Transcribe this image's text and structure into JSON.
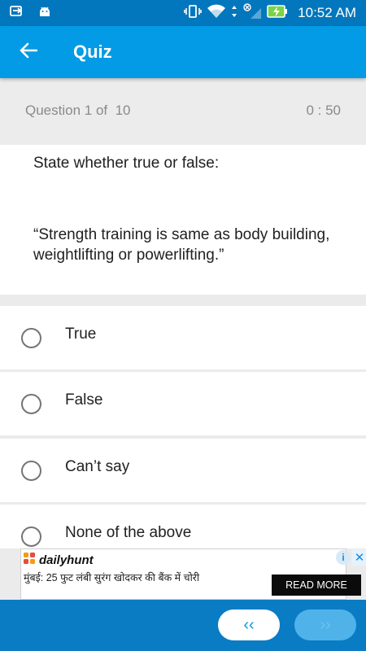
{
  "status_bar": {
    "time": "10:52 AM",
    "icons": [
      "usb-icon",
      "android-icon",
      "vibrate-icon",
      "wifi-icon",
      "data-arrows-icon",
      "no-sim-icon",
      "signal-icon",
      "battery-charging-icon"
    ]
  },
  "app_bar": {
    "title": "Quiz",
    "back_icon": "arrow-back-icon"
  },
  "question_header": {
    "counter": "Question 1 of  10",
    "timer": "0 : 50"
  },
  "question": {
    "instruction": "State whether true or false:",
    "statement": "“Strength training is same as body building, weightlifting or powerlifting.”"
  },
  "options": [
    {
      "label": "True",
      "selected": false
    },
    {
      "label": "False",
      "selected": false
    },
    {
      "label": "Can’t say",
      "selected": false
    },
    {
      "label": "None of the above",
      "selected": false
    }
  ],
  "ad": {
    "brand": "dailyhunt",
    "text": "मुंबई: 25 फुट लंबी सुरंग खोदकर की बैंक में चोरी",
    "cta": "READ MORE",
    "info_icon": "info-icon",
    "close_icon": "close-icon"
  },
  "bottom_nav": {
    "prev_label": "‹‹",
    "next_label": "››"
  },
  "colors": {
    "status_bar": "#0277bd",
    "app_bar": "#039be5",
    "bottom_bar": "#0a7cc4",
    "header_bg": "#ececec"
  }
}
